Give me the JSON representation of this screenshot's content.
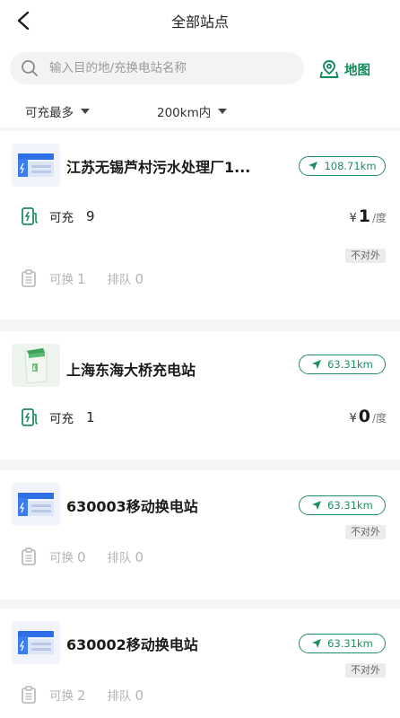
{
  "header": {
    "title": "全部站点"
  },
  "search": {
    "placeholder": "输入目的地/充换电站名称",
    "map_label": "地图"
  },
  "filters": {
    "sort_label": "可充最多",
    "range_label": "200km内"
  },
  "labels": {
    "charge": "可充",
    "swap": "可换",
    "queue": "排队",
    "not_public": "不对外",
    "currency": "¥",
    "price_unit": "/度"
  },
  "stations": [
    {
      "name": "江苏无锡芦村污水处理厂1...",
      "distance": "108.71km",
      "charge_count": "9",
      "price": "1",
      "swap_count": "1",
      "queue_count": "0"
    },
    {
      "name": "上海东海大桥充电站",
      "distance": "63.31km",
      "charge_count": "1",
      "price": "0"
    },
    {
      "name": "630003移动换电站",
      "distance": "63.31km",
      "swap_count": "0",
      "queue_count": "0"
    },
    {
      "name": "630002移动换电站",
      "distance": "63.31km",
      "swap_count": "2",
      "queue_count": "0"
    }
  ],
  "colors": {
    "accent": "#1f8f60",
    "map_green": "#138a5a",
    "swap_blue": "#2e6ee6"
  }
}
